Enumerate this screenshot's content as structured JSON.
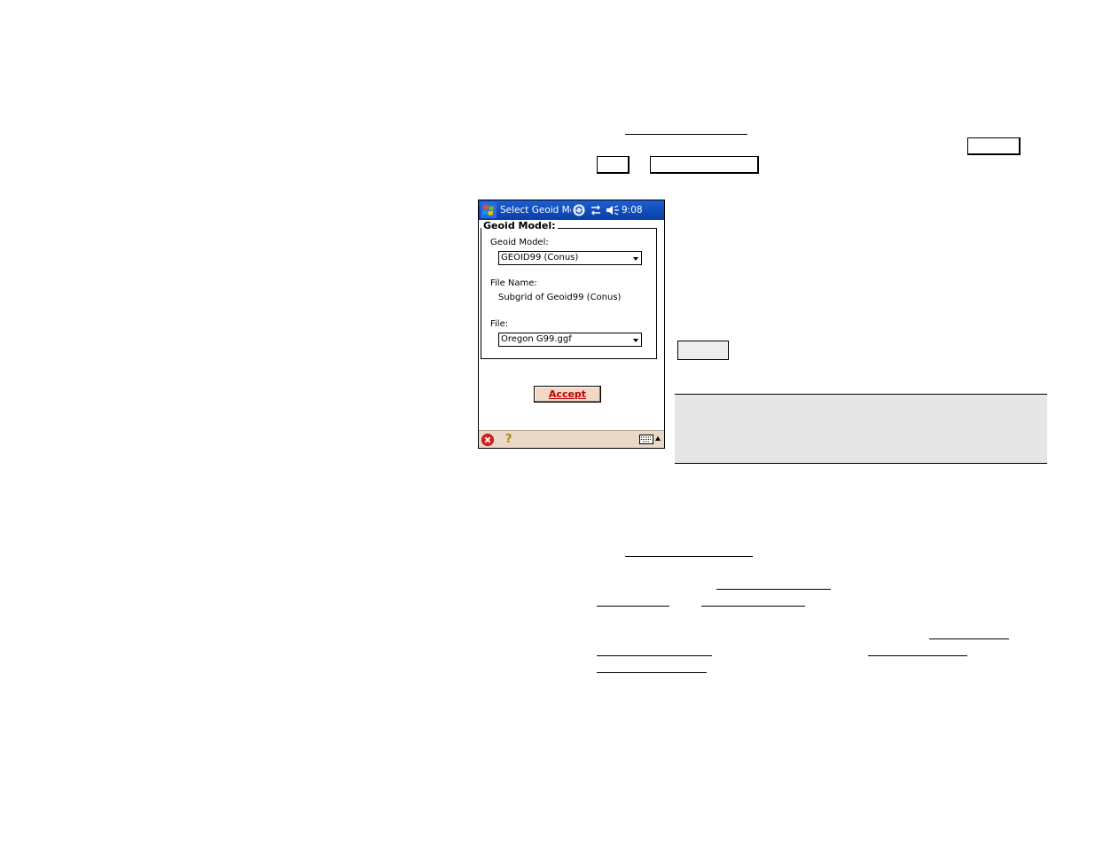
{
  "window": {
    "title": "Select Geoid Mo",
    "clock": "9:08"
  },
  "group": {
    "title": "Geoid Model:"
  },
  "fields": {
    "geoid_model_label": "Geoid Model:",
    "geoid_model_value": "GEOID99 (Conus)",
    "file_name_label": "File Name:",
    "file_name_value": "Subgrid of Geoid99 (Conus)",
    "file_label": "File:",
    "file_value": "Oregon G99.ggf"
  },
  "buttons": {
    "accept_label": "Accept"
  },
  "icons": {
    "start": "windows-flag-icon",
    "sync": "sync-icon",
    "connectivity": "connectivity-arrows-icon",
    "speaker": "speaker-icon",
    "close": "close-icon",
    "help": "help-icon",
    "keyboard": "keyboard-icon",
    "input_arrow": "input-panel-arrow-icon"
  },
  "colors": {
    "titlebar": "#0a3ea8",
    "bottombar": "#e9d8c8",
    "accept_bg": "#f1d7c4",
    "accept_text": "#c00000",
    "note_band": "#e6e6e6"
  }
}
